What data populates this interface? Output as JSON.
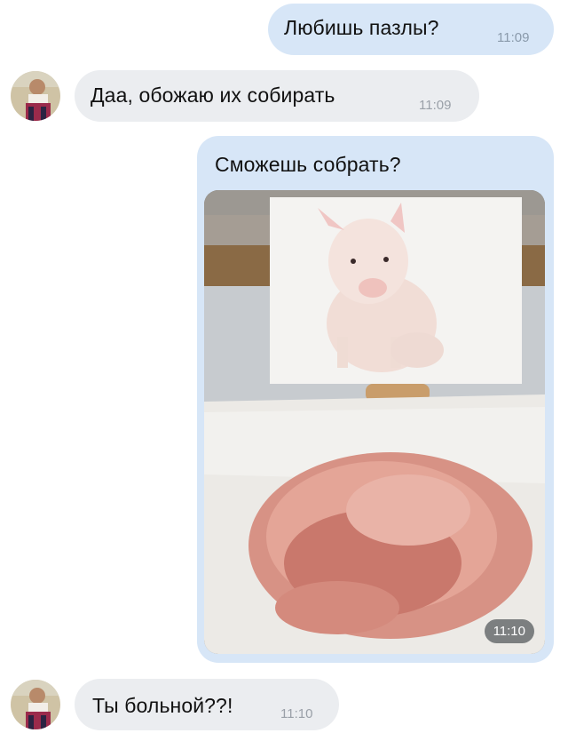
{
  "messages": [
    {
      "direction": "outgoing",
      "text": "Любишь пазлы?",
      "time": "11:09"
    },
    {
      "direction": "incoming",
      "text": "Даа, обожаю их собирать",
      "time": "11:09"
    },
    {
      "direction": "outgoing",
      "text": "Сможешь собрать?",
      "time": "11:10",
      "attachment": "photo"
    },
    {
      "direction": "incoming",
      "text": "Ты больной??!",
      "time": "11:10"
    }
  ],
  "colors": {
    "outgoing_bubble": "#d7e6f7",
    "incoming_bubble": "#ebedf0",
    "time_text": "#8a9aab"
  },
  "icons": [
    "avatar"
  ]
}
